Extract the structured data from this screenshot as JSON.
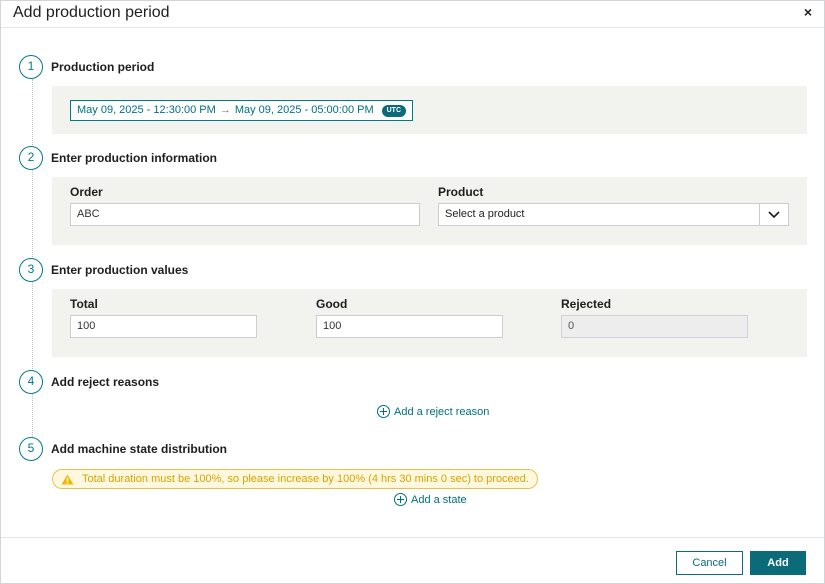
{
  "dialog": {
    "title": "Add production period",
    "close_label": "×"
  },
  "steps": [
    {
      "number": "1",
      "title": "Production period"
    },
    {
      "number": "2",
      "title": "Enter production information"
    },
    {
      "number": "3",
      "title": "Enter production values"
    },
    {
      "number": "4",
      "title": "Add reject reasons"
    },
    {
      "number": "5",
      "title": "Add machine state distribution"
    }
  ],
  "period": {
    "start": "May 09, 2025 - 12:30:00 PM",
    "arrow": "→",
    "end": "May 09, 2025 - 05:00:00 PM",
    "timezone": "UTC"
  },
  "production_info": {
    "order_label": "Order",
    "order_value": "ABC",
    "product_label": "Product",
    "product_placeholder": "Select a product"
  },
  "production_values": {
    "total_label": "Total",
    "total_value": "100",
    "good_label": "Good",
    "good_value": "100",
    "rejected_label": "Rejected",
    "rejected_value": "0"
  },
  "reject_reasons": {
    "add_label": "Add a reject reason"
  },
  "machine_state": {
    "warning_text": "Total duration must be 100%, so please increase by 100% (4 hrs 30 mins 0 sec) to proceed.",
    "add_label": "Add a state"
  },
  "footer": {
    "cancel_label": "Cancel",
    "add_label": "Add"
  },
  "colors": {
    "accent": "#0b6b79",
    "warning": "#e6c34a"
  }
}
